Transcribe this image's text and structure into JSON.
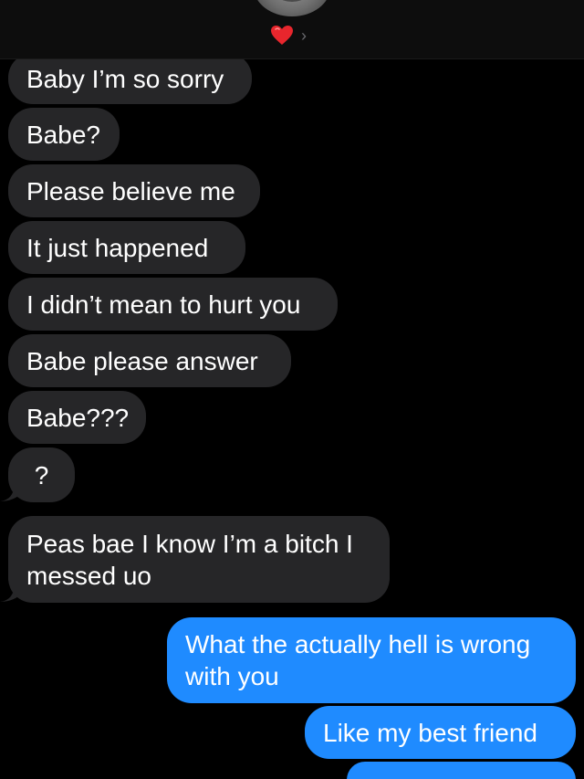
{
  "header": {
    "contact_emoji": "❤️",
    "chevron": "›"
  },
  "messages": [
    {
      "direction": "incoming",
      "text": "Baby I’m so sorry"
    },
    {
      "direction": "incoming",
      "text": "Babe?"
    },
    {
      "direction": "incoming",
      "text": "Please believe me"
    },
    {
      "direction": "incoming",
      "text": "It just happened"
    },
    {
      "direction": "incoming",
      "text": "I didn’t mean to hurt you"
    },
    {
      "direction": "incoming",
      "text": "Babe please answer"
    },
    {
      "direction": "incoming",
      "text": "Babe???"
    },
    {
      "direction": "incoming",
      "text": "?"
    },
    {
      "direction": "incoming",
      "text": "Peas bae I know I’m a bitch I messed uo"
    },
    {
      "direction": "outgoing",
      "text": "What the actually hell is wrong with you"
    },
    {
      "direction": "outgoing",
      "text": "Like my best friend"
    },
    {
      "direction": "outgoing",
      "text": ""
    }
  ],
  "colors": {
    "background": "#000000",
    "incoming_bubble": "#262628",
    "outgoing_bubble": "#1f8bff",
    "text": "#ffffff",
    "heart": "#e8262d"
  }
}
